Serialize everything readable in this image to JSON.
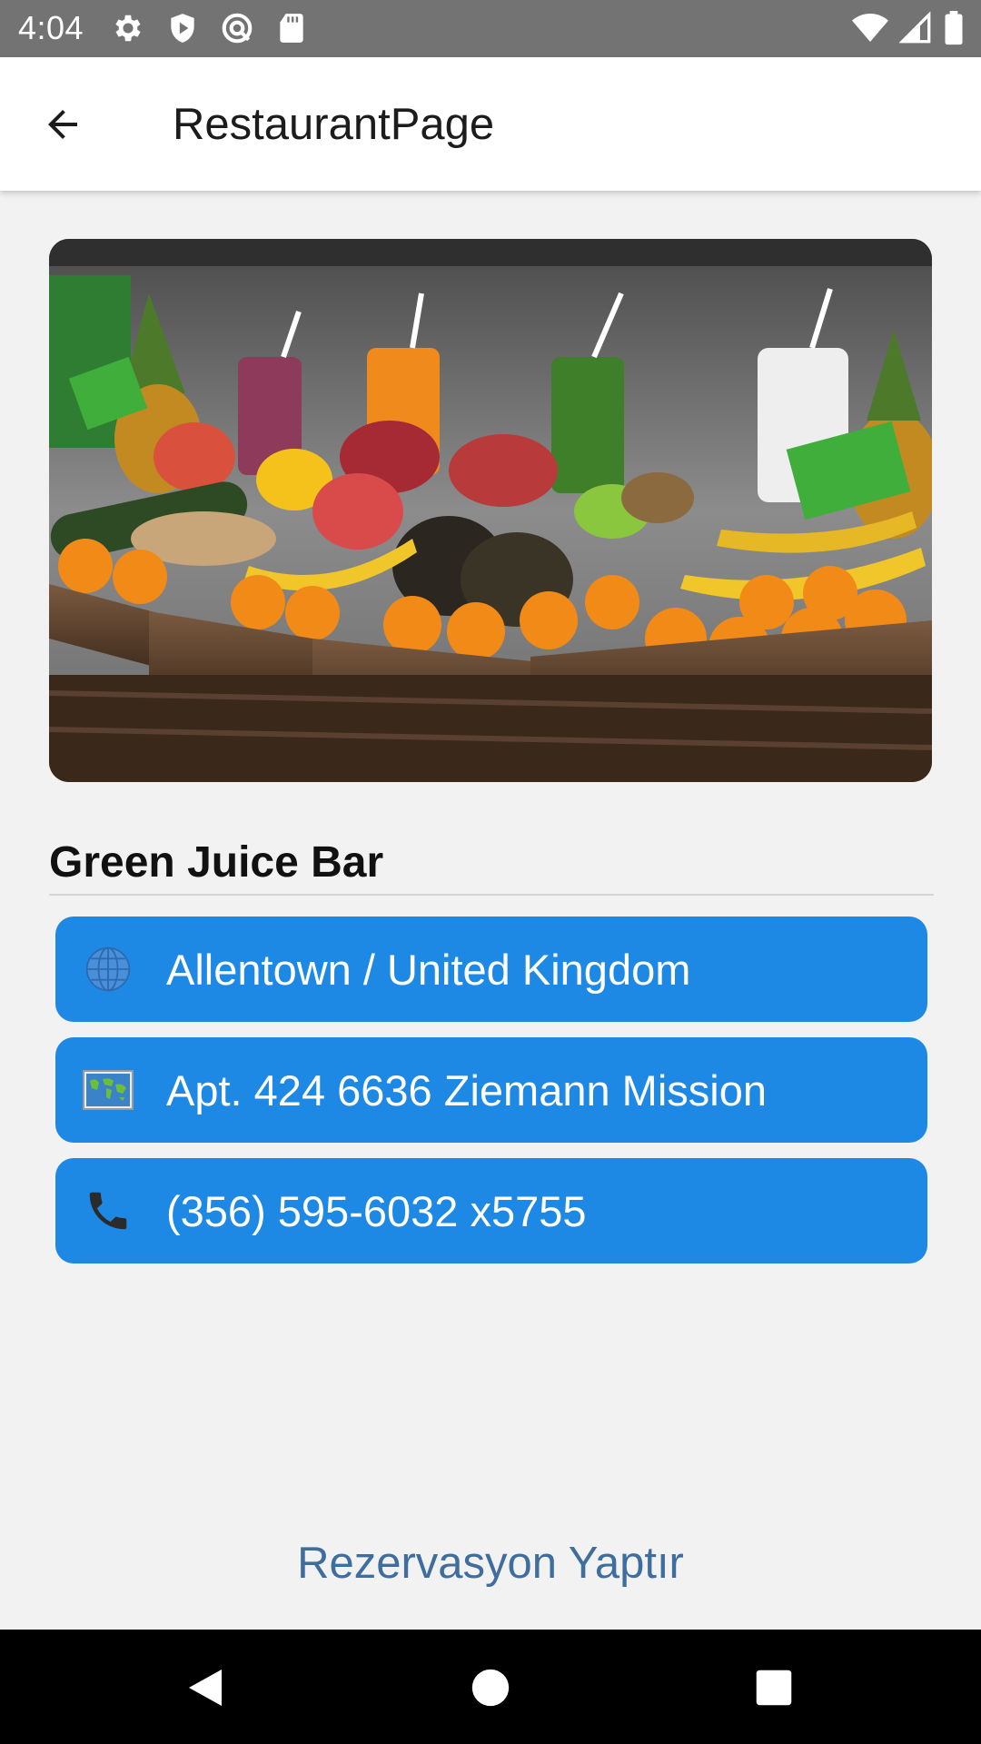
{
  "status_bar": {
    "time": "4:04",
    "left_icons": [
      "gear-icon",
      "play-protect-icon",
      "sync-icon",
      "sd-card-icon"
    ],
    "right_icons": [
      "wifi-icon",
      "cell-signal-icon",
      "battery-icon"
    ]
  },
  "app_bar": {
    "title": "RestaurantPage",
    "back_icon": "arrow-back-icon"
  },
  "restaurant": {
    "name": "Green Juice Bar",
    "image_alt": "fruit-and-juice-display-photo",
    "location": "Allentown / United Kingdom",
    "address": "Apt. 424 6636 Ziemann Mission",
    "phone": "(356) 595-6032 x5755"
  },
  "icons": {
    "location": "globe-icon",
    "address": "world-map-icon",
    "phone": "telephone-icon"
  },
  "actions": {
    "reserve_label": "Rezervasyon Yaptır"
  },
  "nav_bar": {
    "buttons": [
      "nav-back-icon",
      "nav-home-icon",
      "nav-recents-icon"
    ]
  },
  "colors": {
    "status_bar": "#737373",
    "app_bar": "#ffffff",
    "background": "#f2f2f2",
    "card": "#1e88e5",
    "reserve_text": "#3f6e9e",
    "nav_bar": "#000000"
  }
}
